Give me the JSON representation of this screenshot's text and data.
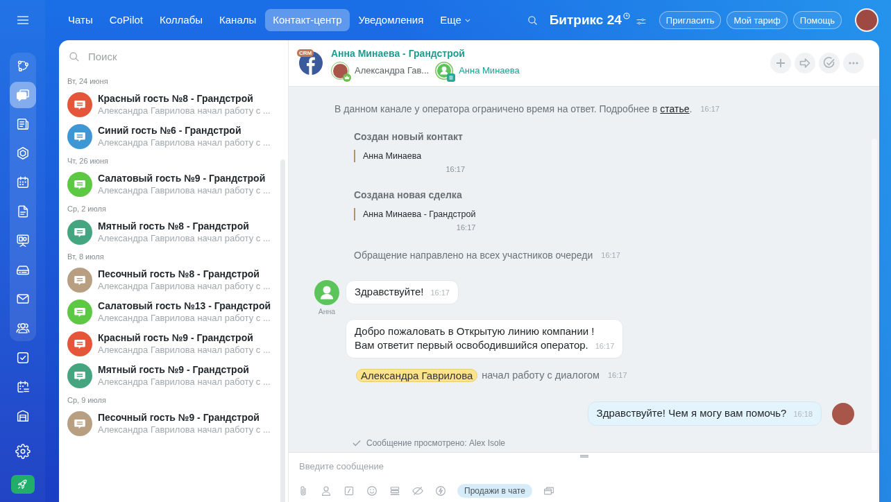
{
  "top_nav": {
    "items": [
      {
        "kind": "tab",
        "label": "Чаты",
        "selected": false
      },
      {
        "kind": "tab",
        "label": "CoPilot",
        "selected": false
      },
      {
        "kind": "tab",
        "label": "Коллабы",
        "selected": false
      },
      {
        "kind": "tab",
        "label": "Каналы",
        "selected": false
      },
      {
        "kind": "tab",
        "label": "Контакт-центр",
        "selected": true
      },
      {
        "kind": "tab",
        "label": "Уведомления",
        "selected": false
      },
      {
        "kind": "menu",
        "label": "Еще",
        "selected": false
      }
    ],
    "logo": "Битрикс 24",
    "buttons": [
      "Пригласить",
      "Мой тариф",
      "Помощь"
    ]
  },
  "sidebar": {
    "group_items": [
      {
        "selected": false
      },
      {
        "selected": true
      },
      {
        "selected": false
      },
      {
        "selected": false
      },
      {
        "selected": false
      },
      {
        "selected": false
      },
      {
        "selected": false
      },
      {
        "selected": false
      },
      {
        "selected": false
      },
      {
        "selected": false
      }
    ],
    "items": [
      {
        "selected": false
      },
      {
        "selected": false
      },
      {
        "selected": false
      },
      {
        "selected": false
      }
    ]
  },
  "chat_list": {
    "search": {
      "placeholder": "Поиск"
    },
    "groups": [
      {
        "date": "Вт, 24 июня",
        "chats": [
          {
            "title": "Красный гость №8 - Грандстрой",
            "preview": "Александра Гаврилова начал работу с ...",
            "color": "#e4553a"
          },
          {
            "title": "Синий гость №6 - Грандстрой",
            "preview": "Александра Гаврилова начал работу с ...",
            "color": "#3d97d5"
          }
        ]
      },
      {
        "date": "Чт, 26 июня",
        "chats": [
          {
            "title": "Салатовый гость №9 - Грандстрой",
            "preview": "Александра Гаврилова начал работу с ...",
            "color": "#5cc843"
          }
        ]
      },
      {
        "date": "Ср, 2 июля",
        "chats": [
          {
            "title": "Мятный гость №8 - Грандстрой",
            "preview": "Александра Гаврилова начал работу с ...",
            "color": "#44a580"
          }
        ]
      },
      {
        "date": "Вт, 8 июля",
        "chats": [
          {
            "title": "Песочный гость №8 - Грандстрой",
            "preview": "Александра Гаврилова начал работу с ...",
            "color": "#b89f82"
          },
          {
            "title": "Салатовый гость №13 - Грандстрой",
            "preview": "Александра Гаврилова начал работу с ...",
            "color": "#5cc843"
          },
          {
            "title": "Красный гость №9 - Грандстрой",
            "preview": "Александра Гаврилова начал работу с ...",
            "color": "#e4553a"
          },
          {
            "title": "Мятный гость №9 - Грандстрой",
            "preview": "Александра Гаврилова начал работу с ...",
            "color": "#44a580"
          }
        ]
      },
      {
        "date": "Ср, 9 июля",
        "chats": [
          {
            "title": "Песочный гость №9 - Грандстрой",
            "preview": "Александра Гаврилова начал работу с ...",
            "color": "#b89f82"
          }
        ]
      }
    ]
  },
  "chat": {
    "badge": "CRM",
    "title": "Анна Минаева - Грандстрой",
    "participants": [
      {
        "kind": "operator",
        "name": "Александра Гав..."
      },
      {
        "kind": "client",
        "name": "Анна Минаева"
      }
    ],
    "messages": [
      {
        "kind": "notice",
        "text": "В данном канале у оператора ограничено время на ответ. Подробнее в",
        "link": "статье",
        "end": ".",
        "time": "16:17"
      },
      {
        "kind": "entity",
        "title": "Создан новый контакт",
        "item": "Анна Минаева",
        "time": "16:17"
      },
      {
        "kind": "entity",
        "title": "Создана новая сделка",
        "item": "Анна Минаева - Грандстрой",
        "time": "16:17"
      },
      {
        "kind": "system",
        "text": "Обращение направлено на всех участников очереди",
        "time": "16:17"
      },
      {
        "kind": "incoming",
        "author": "Анна",
        "text": "Здравствуйте!",
        "time": "16:17"
      },
      {
        "kind": "incoming",
        "text": "Добро пожаловать в Открытую линию компании !\nВам ответит первый освободившийся оператор.",
        "time": "16:17"
      },
      {
        "kind": "join",
        "name": "Александра Гаврилова",
        "text": "начал работу с диалогом",
        "time": "16:17"
      },
      {
        "kind": "outgoing",
        "text": "Здравствуйте! Чем я могу вам помочь?",
        "time": "16:18"
      },
      {
        "kind": "seen",
        "text": "Сообщение просмотрено: Alex Isole"
      }
    ],
    "composer": {
      "placeholder": "Введите сообщение",
      "sales_button": "Продажи в чате"
    }
  }
}
